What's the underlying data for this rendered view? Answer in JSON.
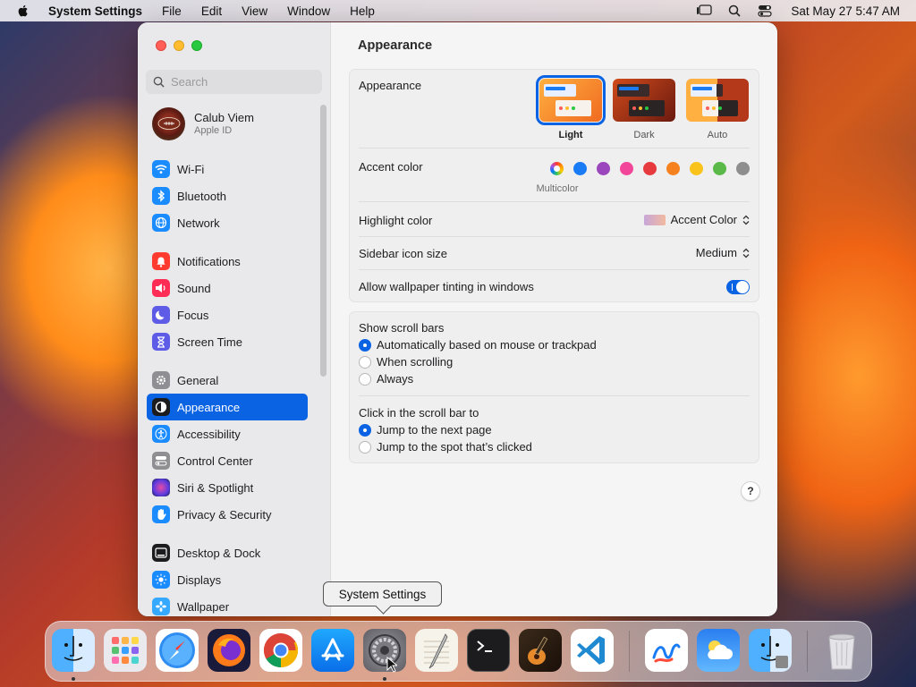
{
  "menubar": {
    "app_name": "System Settings",
    "menus": [
      "File",
      "Edit",
      "View",
      "Window",
      "Help"
    ],
    "clock": "Sat May 27  5:47 AM"
  },
  "sidebar": {
    "search_placeholder": "Search",
    "account": {
      "name": "Calub Viem",
      "subtitle": "Apple ID"
    },
    "items": [
      {
        "label": "Wi-Fi",
        "icon": "wifi-icon",
        "color": "#1a8cff"
      },
      {
        "label": "Bluetooth",
        "icon": "bluetooth-icon",
        "color": "#1a8cff"
      },
      {
        "label": "Network",
        "icon": "globe-icon",
        "color": "#1a8cff"
      },
      {
        "label": "Notifications",
        "icon": "bell-icon",
        "color": "#ff3b30"
      },
      {
        "label": "Sound",
        "icon": "speaker-icon",
        "color": "#ff2d55"
      },
      {
        "label": "Focus",
        "icon": "moon-icon",
        "color": "#5e5ce6"
      },
      {
        "label": "Screen Time",
        "icon": "hourglass-icon",
        "color": "#5e5ce6"
      },
      {
        "label": "General",
        "icon": "gear-icon",
        "color": "#8e8e93"
      },
      {
        "label": "Appearance",
        "icon": "appearance-icon",
        "color": "#1c1c1e"
      },
      {
        "label": "Accessibility",
        "icon": "accessibility-icon",
        "color": "#1a8cff"
      },
      {
        "label": "Control Center",
        "icon": "toggles-icon",
        "color": "#8e8e93"
      },
      {
        "label": "Siri & Spotlight",
        "icon": "siri-icon",
        "color": "#7a3ee0"
      },
      {
        "label": "Privacy & Security",
        "icon": "hand-icon",
        "color": "#1a8cff"
      },
      {
        "label": "Desktop & Dock",
        "icon": "desktop-icon",
        "color": "#1c1c1e"
      },
      {
        "label": "Displays",
        "icon": "sun-icon",
        "color": "#1a8cff"
      },
      {
        "label": "Wallpaper",
        "icon": "flower-icon",
        "color": "#35a8ff"
      }
    ],
    "selected": "Appearance"
  },
  "main": {
    "title": "Appearance",
    "appearance": {
      "label": "Appearance",
      "options": [
        "Light",
        "Dark",
        "Auto"
      ],
      "selected": "Light"
    },
    "accent": {
      "label": "Accent color",
      "colors": [
        "multicolor",
        "#1a7cf5",
        "#9b46bd",
        "#f2469a",
        "#e63a3e",
        "#f5821f",
        "#f9c31c",
        "#5bb94a",
        "#8e8e8e"
      ],
      "selected_caption": "Multicolor"
    },
    "highlight": {
      "label": "Highlight color",
      "value": "Accent Color"
    },
    "sidebar_icon_size": {
      "label": "Sidebar icon size",
      "value": "Medium"
    },
    "wallpaper_tinting": {
      "label": "Allow wallpaper tinting in windows",
      "enabled": true
    },
    "scroll_bars": {
      "label": "Show scroll bars",
      "options": [
        "Automatically based on mouse or trackpad",
        "When scrolling",
        "Always"
      ],
      "selected": 0
    },
    "click_scroll": {
      "label": "Click in the scroll bar to",
      "options": [
        "Jump to the next page",
        "Jump to the spot that’s clicked"
      ],
      "selected": 0
    },
    "help_label": "?"
  },
  "tooltip": "System Settings",
  "dock": {
    "apps": [
      "Finder",
      "Launchpad",
      "Safari",
      "Firefox",
      "Chrome",
      "App Store",
      "System Settings",
      "TextEdit",
      "Terminal",
      "GarageBand",
      "Visual Studio Code",
      "Freeform",
      "Weather",
      "Migration Assistant",
      "Trash"
    ]
  }
}
